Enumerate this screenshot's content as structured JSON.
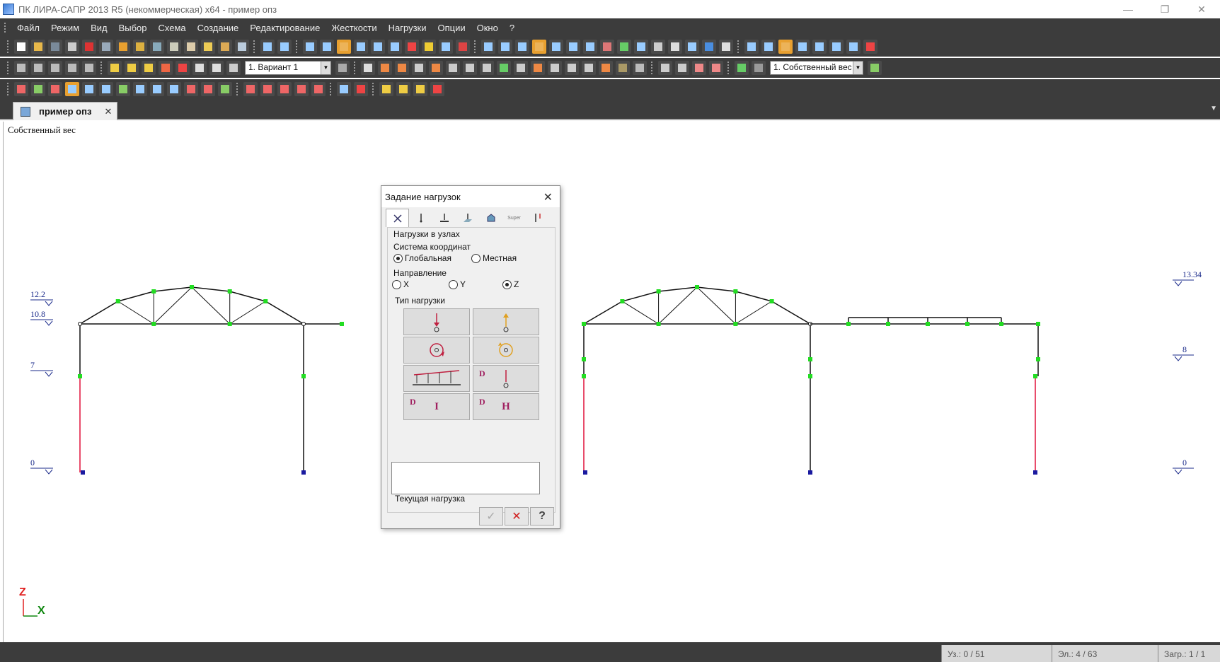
{
  "window": {
    "title": "ПК ЛИРА-САПР  2013 R5 (некоммерческая) x64 - пример опз",
    "controls": [
      "—",
      "❐",
      "✕"
    ]
  },
  "menu": [
    "Файл",
    "Режим",
    "Вид",
    "Выбор",
    "Схема",
    "Создание",
    "Редактирование",
    "Жесткости",
    "Нагрузки",
    "Опции",
    "Окно",
    "?"
  ],
  "toolbar": {
    "variant_combo": "1. Вариант 1",
    "loadcase_combo": "1. Собственный вес"
  },
  "document_tab": {
    "label": "пример опз",
    "close": "✕"
  },
  "canvas": {
    "caption": "Собственный вес",
    "level_labels_left": [
      "12.2",
      "10.8",
      "7",
      "0"
    ],
    "level_labels_right": [
      "13.34",
      "8",
      "0"
    ],
    "axis_z": "Z",
    "axis_x": "X",
    "colors": {
      "node": "#22dd22",
      "support": "#1a1aa0",
      "member": "#111111",
      "column_highlight": "#e0103a",
      "level": "#1a2a8a"
    }
  },
  "dialog": {
    "title": "Задание нагрузок",
    "close": "✕",
    "tab_icons": [
      "scissors-icon",
      "node-load-icon",
      "bar-load-icon",
      "plate-load-icon",
      "solid-load-icon",
      "super-element-icon",
      "dynamic-load-icon"
    ],
    "tab_super_label": "Super",
    "section_title": "Нагрузки в узлах",
    "coord_system": {
      "label": "Система координат",
      "global": "Глобальная",
      "local": "Местная",
      "selected": "global"
    },
    "direction": {
      "label": "Направление",
      "x": "X",
      "y": "Y",
      "z": "Z",
      "selected": "z"
    },
    "load_type_label": "Тип нагрузки",
    "load_type_d": "D",
    "load_type_i": "I",
    "load_type_h": "H",
    "current_load_label": "Текущая нагрузка",
    "current_load_value": "",
    "buttons": {
      "ok": "✓",
      "cancel": "✕",
      "help": "?"
    }
  },
  "status": {
    "nodes": "Уз.: 0 / 51",
    "elements": "Эл.: 4 / 63",
    "loads": "Загр.: 1 / 1"
  }
}
